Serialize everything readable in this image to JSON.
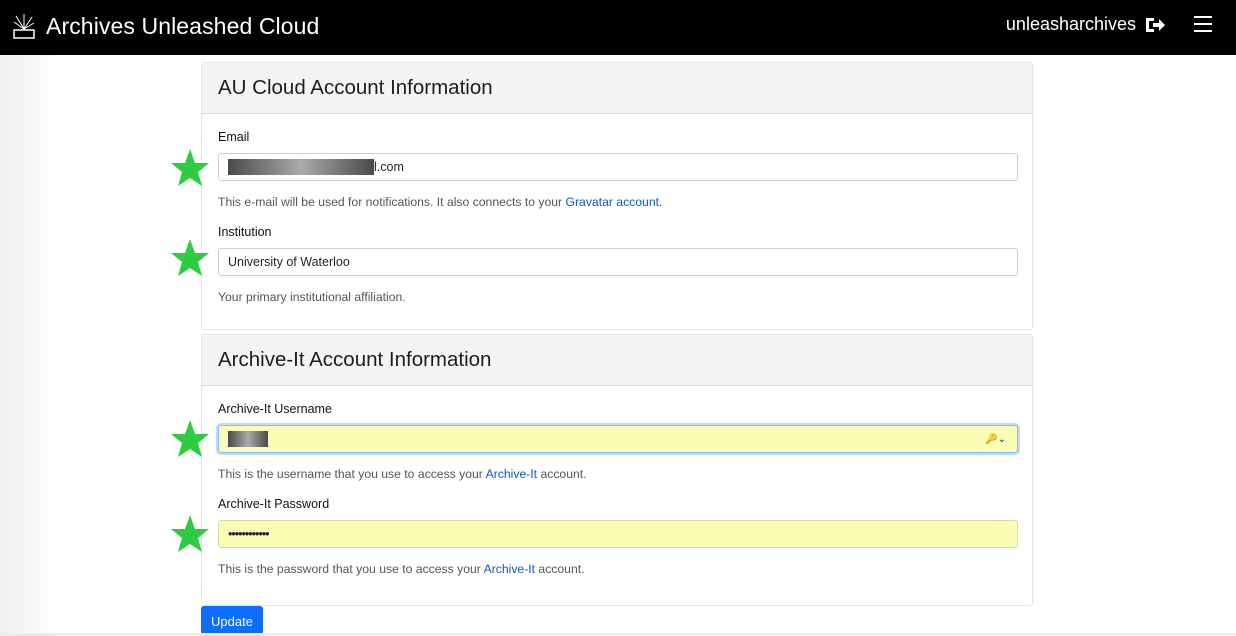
{
  "app": {
    "title": "Archives Unleashed Cloud",
    "username": "unleasharchives",
    "icons": {
      "logo": "archive-logo-icon",
      "logout": "sign-out-icon",
      "menu": "hamburger-menu-icon"
    }
  },
  "au_cloud_section": {
    "heading": "AU Cloud Account Information",
    "email": {
      "label": "Email",
      "value_suffix": "l.com",
      "help_text": "This e-mail will be used for notifications. It also connects to your ",
      "help_link": "Gravatar account",
      "help_end": "."
    },
    "institution": {
      "label": "Institution",
      "value": "University of Waterloo",
      "help_text": "Your primary institutional affiliation."
    }
  },
  "archive_it_section": {
    "heading": "Archive-It Account Information",
    "username": {
      "label": "Archive-It Username",
      "help_text": "This is the username that you use to access your ",
      "help_link": "Archive-It",
      "help_end": " account."
    },
    "password": {
      "label": "Archive-It Password",
      "value": "••••••••••••",
      "help_text": "This is the password that you use to access your ",
      "help_link": "Archive-It",
      "help_end": " account."
    }
  },
  "actions": {
    "update_label": "Update"
  },
  "colors": {
    "star": "#2ecc40",
    "primary": "#0d6efd",
    "autofill": "#fbfdb4"
  }
}
